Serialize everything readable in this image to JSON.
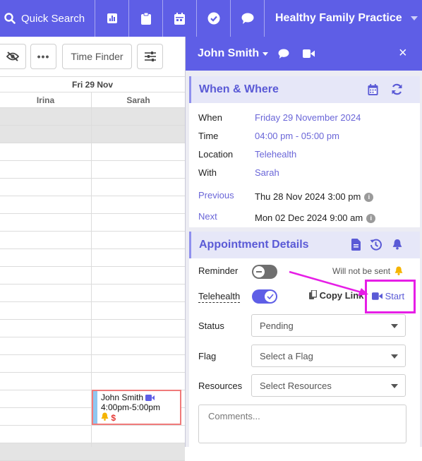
{
  "topbar": {
    "search_label": "Quick Search",
    "icons": [
      "chart-icon",
      "clipboard-icon",
      "calendar-icon",
      "check-circle-icon",
      "chat-icon"
    ],
    "practice_name": "Healthy Family Practice"
  },
  "calendar": {
    "toolbar": {
      "time_finder": "Time Finder"
    },
    "date_header": "Fri 29 Nov",
    "columns": [
      "Irina",
      "Sarah"
    ],
    "appointment": {
      "name": "John Smith",
      "time": "4:00pm-5:00pm",
      "money": "$"
    }
  },
  "panel": {
    "patient_name": "John Smith",
    "when_where": {
      "title": "When & Where",
      "rows": [
        {
          "label": "When",
          "value": "Friday 29 November 2024"
        },
        {
          "label": "Time",
          "value": "04:00 pm - 05:00 pm"
        },
        {
          "label": "Location",
          "value": "Telehealth"
        },
        {
          "label": "With",
          "value": "Sarah"
        }
      ],
      "previous": {
        "label": "Previous",
        "value": "Thu 28 Nov 2024 3:00 pm"
      },
      "next": {
        "label": "Next",
        "value": "Mon 02 Dec 2024 9:00 am"
      }
    },
    "details": {
      "title": "Appointment Details",
      "reminder_label": "Reminder",
      "reminder_status": "Will not be sent",
      "telehealth_label": "Telehealth",
      "copy_link": "Copy Link",
      "start": "Start",
      "status_label": "Status",
      "status_value": "Pending",
      "flag_label": "Flag",
      "flag_placeholder": "Select a Flag",
      "resources_label": "Resources",
      "resources_placeholder": "Select Resources",
      "comments_placeholder": "Comments..."
    }
  },
  "colors": {
    "brand": "#5e5ee6",
    "link": "#6a66d8",
    "highlight": "#e61ee6",
    "alert": "#e53935",
    "bell": "#f5b400"
  }
}
